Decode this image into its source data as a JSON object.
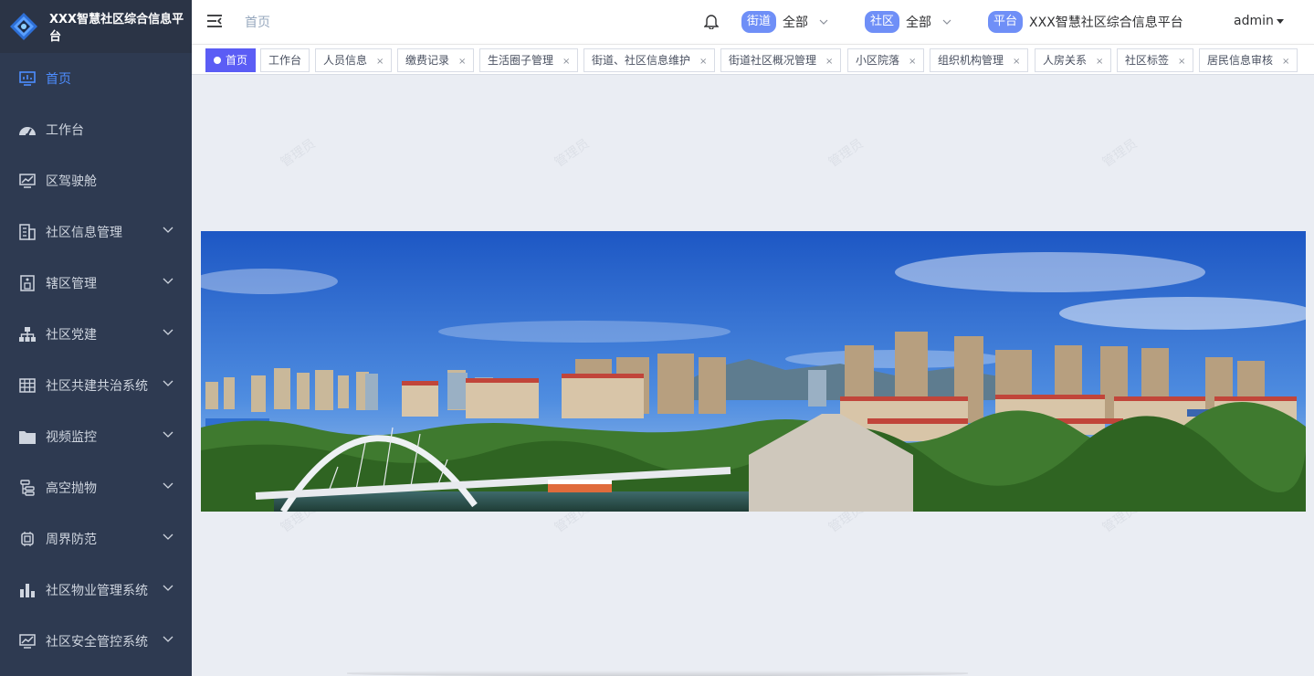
{
  "app": {
    "title": "XXX智慧社区综合信息平台"
  },
  "sidebar": {
    "items": [
      {
        "label": "首页",
        "icon": "dashboard-monitor-icon",
        "active": true,
        "expandable": false
      },
      {
        "label": "工作台",
        "icon": "speedometer-icon",
        "active": false,
        "expandable": false
      },
      {
        "label": "区驾驶舱",
        "icon": "chart-monitor-icon",
        "active": false,
        "expandable": false
      },
      {
        "label": "社区信息管理",
        "icon": "building-icon",
        "active": false,
        "expandable": true
      },
      {
        "label": "辖区管理",
        "icon": "district-icon",
        "active": false,
        "expandable": true
      },
      {
        "label": "社区党建",
        "icon": "org-tree-icon",
        "active": false,
        "expandable": true
      },
      {
        "label": "社区共建共治系统",
        "icon": "table-grid-icon",
        "active": false,
        "expandable": true
      },
      {
        "label": "视频监控",
        "icon": "folder-icon",
        "active": false,
        "expandable": true
      },
      {
        "label": "高空抛物",
        "icon": "tree-list-icon",
        "active": false,
        "expandable": true
      },
      {
        "label": "周界防范",
        "icon": "chip-icon",
        "active": false,
        "expandable": true
      },
      {
        "label": "社区物业管理系统",
        "icon": "bar-chart-icon",
        "active": false,
        "expandable": true
      },
      {
        "label": "社区安全管控系统",
        "icon": "chart-monitor-icon",
        "active": false,
        "expandable": true
      }
    ]
  },
  "header": {
    "breadcrumb": "首页",
    "street": {
      "tag": "街道",
      "value": "全部"
    },
    "community": {
      "tag": "社区",
      "value": "全部"
    },
    "platform": {
      "tag": "平台",
      "value": "XXX智慧社区综合信息平台"
    },
    "user": "admin"
  },
  "tags": [
    {
      "label": "首页",
      "active": true,
      "closable": false
    },
    {
      "label": "工作台",
      "active": false,
      "closable": false
    },
    {
      "label": "人员信息",
      "active": false,
      "closable": true
    },
    {
      "label": "缴费记录",
      "active": false,
      "closable": true
    },
    {
      "label": "生活圈子管理",
      "active": false,
      "closable": true
    },
    {
      "label": "街道、社区信息维护",
      "active": false,
      "closable": true
    },
    {
      "label": "街道社区概况管理",
      "active": false,
      "closable": true
    },
    {
      "label": "小区院落",
      "active": false,
      "closable": true
    },
    {
      "label": "组织机构管理",
      "active": false,
      "closable": true
    },
    {
      "label": "人房关系",
      "active": false,
      "closable": true
    },
    {
      "label": "社区标签",
      "active": false,
      "closable": true
    },
    {
      "label": "居民信息审核",
      "active": false,
      "closable": true
    }
  ],
  "tag_close": "×",
  "watermark": "管理员",
  "colors": {
    "sidebar_bg": "#2e3a51",
    "accent": "#4d8dff",
    "active_tag": "#5b5df5",
    "pill": "#6f8ff7",
    "main_bg": "#eaedf3"
  }
}
